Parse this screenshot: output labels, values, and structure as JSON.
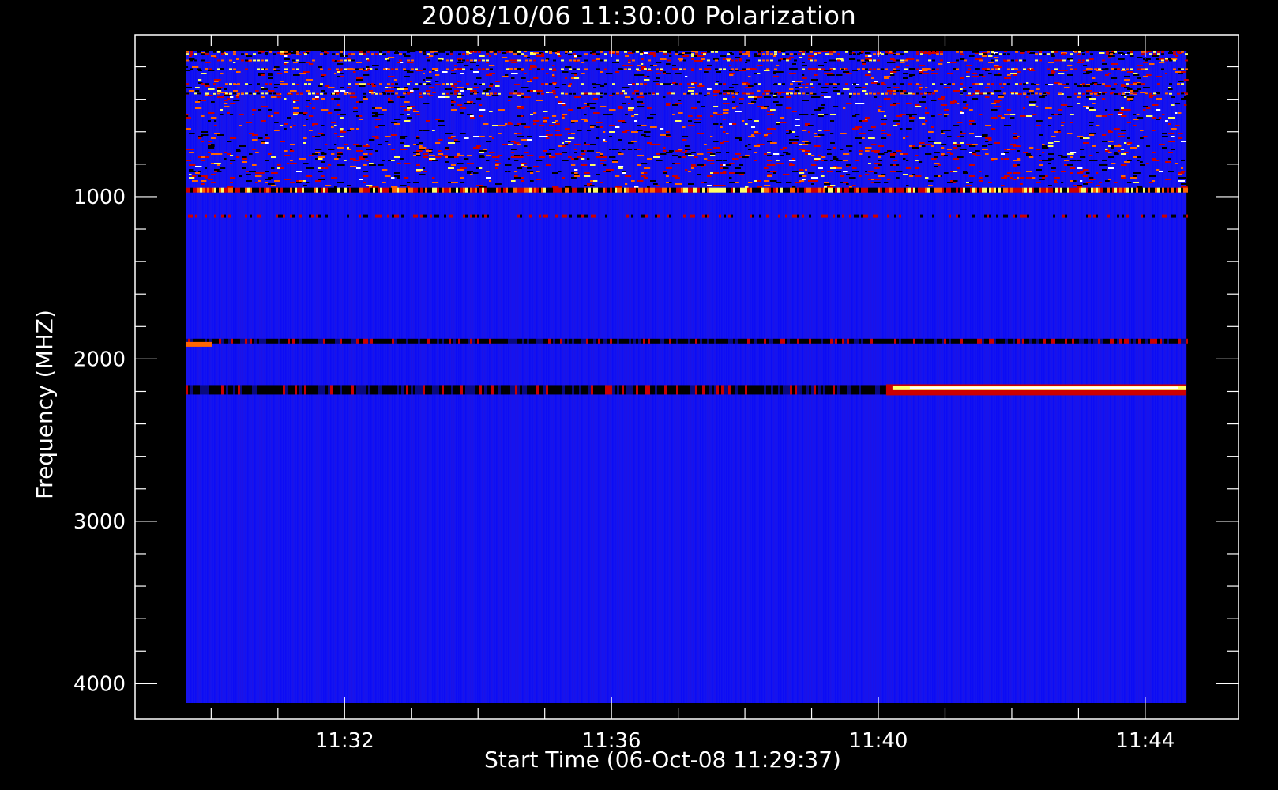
{
  "chart_data": {
    "type": "heatmap",
    "title": "2008/10/06 11:30:00 Polarization",
    "xlabel": "Start Time (06-Oct-08 11:29:37)",
    "ylabel": "Frequency (MHZ)",
    "x_ticks": [
      "11:32",
      "11:36",
      "11:40",
      "11:44"
    ],
    "x_tick_values_min": [
      2.383,
      6.383,
      10.383,
      14.383
    ],
    "x_range_min": [
      0,
      15
    ],
    "y_ticks": [
      "1000",
      "2000",
      "3000",
      "4000"
    ],
    "y_tick_values": [
      1000,
      2000,
      3000,
      4000
    ],
    "y_range": [
      100,
      4120
    ],
    "y_inverted": true,
    "colormap": [
      "#000000",
      "#0000ff",
      "#cc0000",
      "#ff6600",
      "#ffff66",
      "#ffffff"
    ],
    "background_color": "#1414f0",
    "features": [
      {
        "label": "noisy RFI band",
        "y_from": 100,
        "y_to": 940,
        "x_from_min": 0,
        "x_to_min": 15,
        "intensity": "mixed"
      },
      {
        "label": "RFI line",
        "y": 960,
        "x_from_min": 0,
        "x_to_min": 15,
        "intensity": "mixed"
      },
      {
        "label": "weak line",
        "y": 1120,
        "x_from_min": 0,
        "x_to_min": 15,
        "intensity": "weak"
      },
      {
        "label": "RFI line",
        "y": 1890,
        "x_from_min": 0,
        "x_to_min": 15,
        "intensity": "dark"
      },
      {
        "label": "red burst",
        "y": 1910,
        "x_from_min": 0,
        "x_to_min": 0.4,
        "intensity": "high"
      },
      {
        "label": "dark band",
        "y": 2190,
        "x_from_min": 0,
        "x_to_min": 10.5,
        "intensity": "dark"
      },
      {
        "label": "strong emission",
        "y": 2190,
        "x_from_min": 10.5,
        "x_to_min": 15,
        "intensity": "saturated"
      }
    ]
  }
}
